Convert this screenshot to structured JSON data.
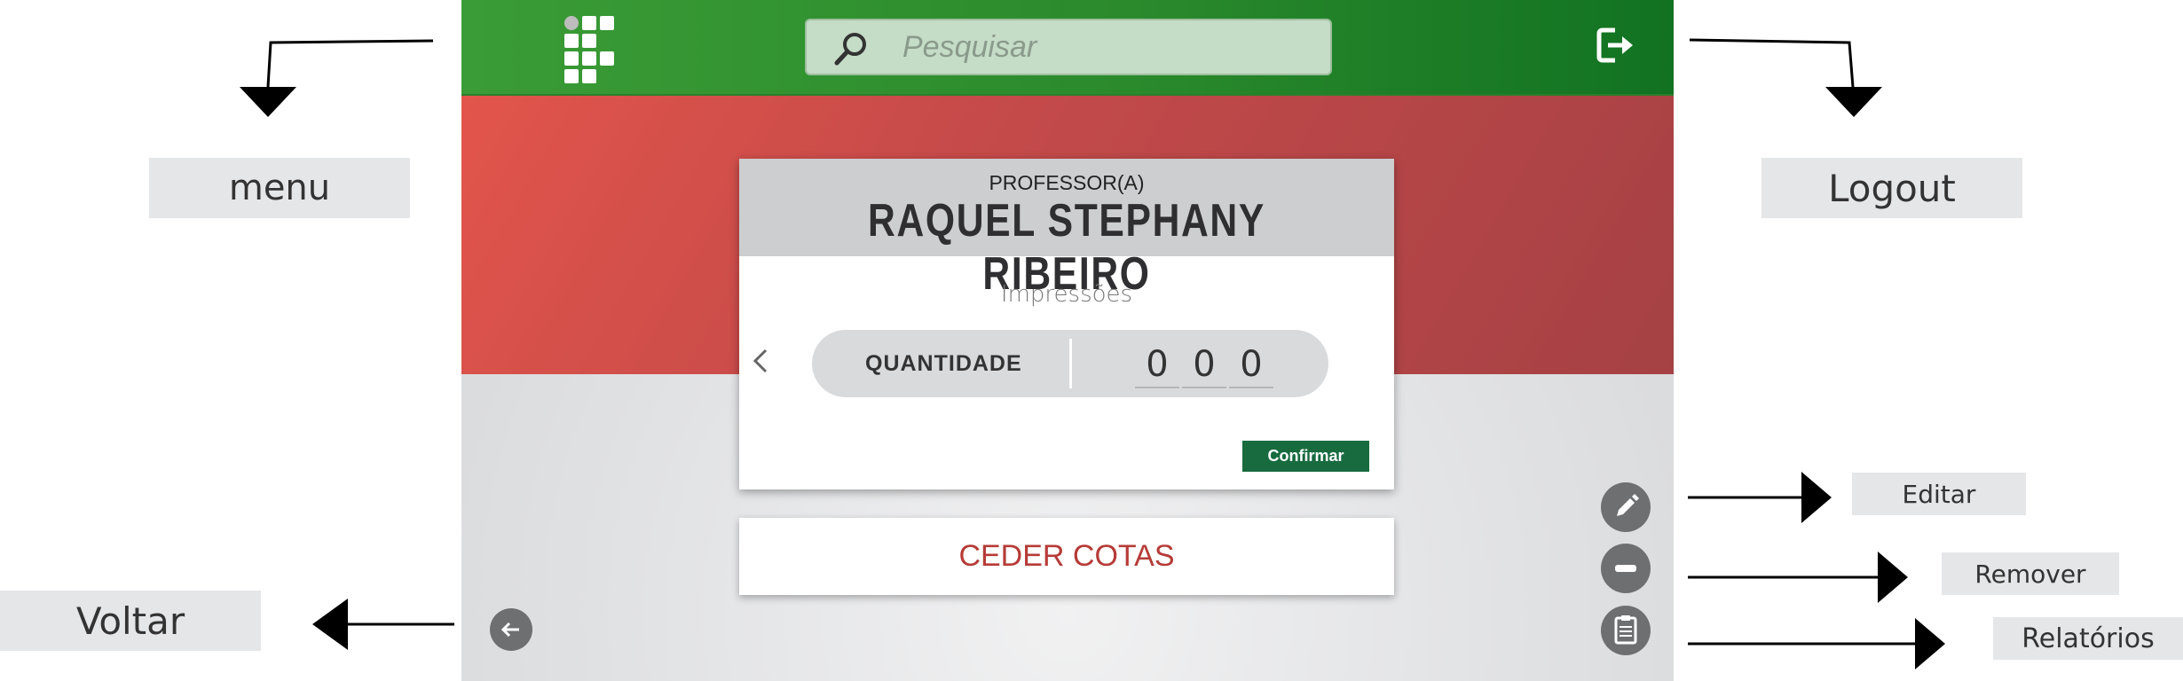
{
  "header": {
    "search_placeholder": "Pesquisar",
    "logo_icon": "institute-grid-logo",
    "logout_icon": "logout-icon"
  },
  "card": {
    "role": "PROFESSOR(A)",
    "name": "RAQUEL STEPHANY RIBEIRO",
    "subtitle": "Impressões",
    "quantity_label": "QUANTIDADE",
    "digits": [
      "0",
      "0",
      "0"
    ],
    "confirm_label": "Confirmar"
  },
  "actions": {
    "ceder_label": "CEDER COTAS",
    "edit_icon": "pencil-icon",
    "remove_icon": "minus-icon",
    "reports_icon": "clipboard-icon",
    "back_icon": "arrow-left-icon"
  },
  "annotations": {
    "menu": "menu",
    "logout": "Logout",
    "editar": "Editar",
    "remover": "Remover",
    "relatorios": "Relatórios",
    "voltar": "Voltar"
  },
  "colors": {
    "header_green": "#2b8a2c",
    "band_red": "#c54a4a",
    "confirm_green": "#176b3f",
    "ceder_red": "#b63b37",
    "fab_gray": "#6e6f71"
  }
}
